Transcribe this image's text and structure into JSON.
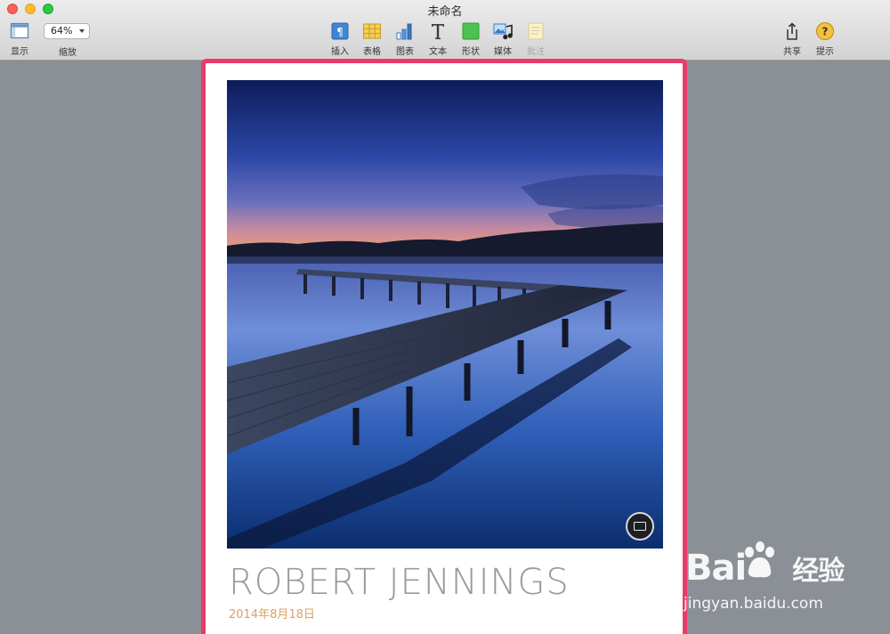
{
  "window": {
    "title": "未命名"
  },
  "toolbar": {
    "view_label": "显示",
    "zoom_value": "64%",
    "zoom_label": "缩放",
    "insert_label": "插入",
    "table_label": "表格",
    "chart_label": "图表",
    "text_label": "文本",
    "shape_label": "形状",
    "media_label": "媒体",
    "comment_label": "批注",
    "share_label": "共享",
    "tips_label": "提示"
  },
  "document": {
    "name": "ROBERT JENNINGS",
    "date": "2014年8月18日"
  },
  "watermark": {
    "logo_text": "Bai",
    "logo_suffix": "经验",
    "url": "jingyan.baidu.com"
  },
  "colors": {
    "selection_border": "#ea3a6a",
    "date_text": "#d7a262",
    "canvas_bg": "#8b8f96"
  }
}
